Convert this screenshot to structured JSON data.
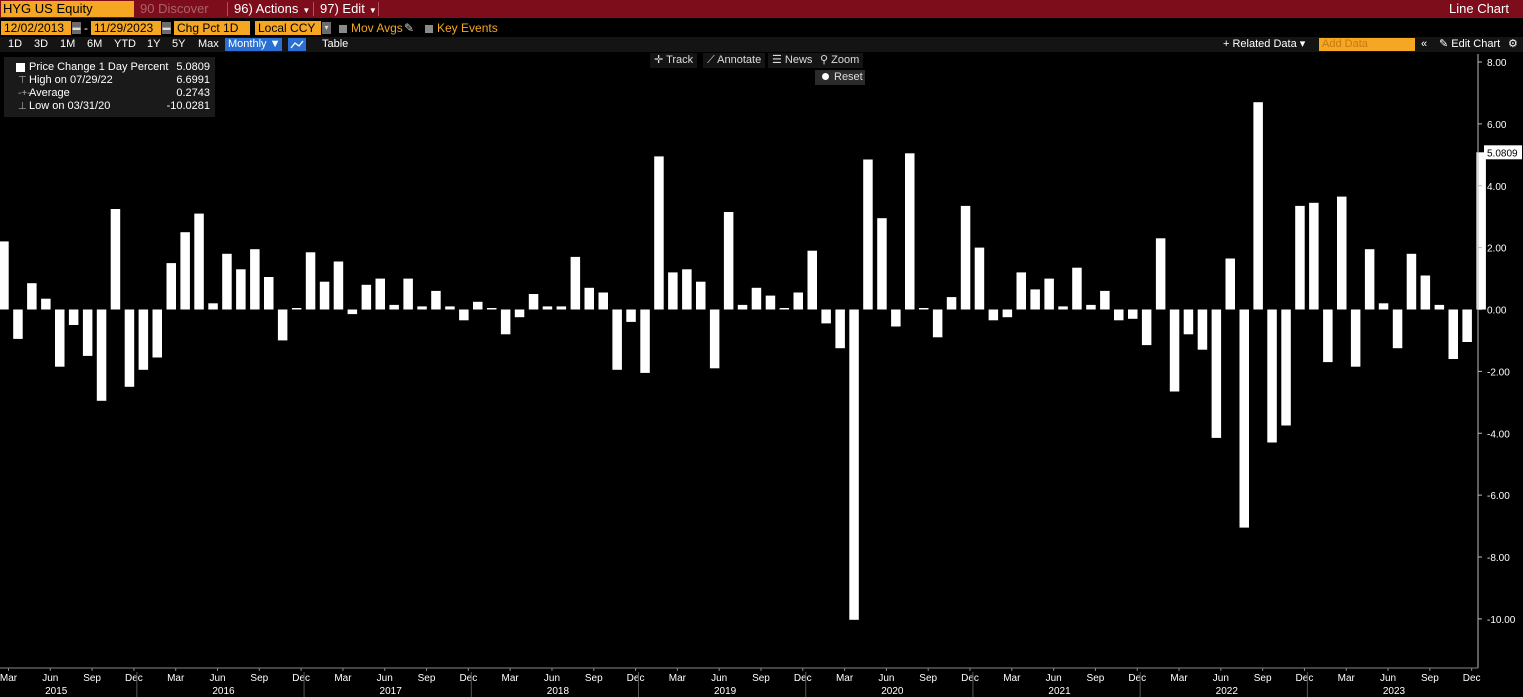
{
  "topbar": {
    "ticker": "HYG US Equity",
    "discover": "90 Discover",
    "actions": "96) Actions",
    "edit": "97) Edit",
    "chart_type": "Line Chart"
  },
  "controls": {
    "start_date": "12/02/2013",
    "end_date": "11/29/2023",
    "field": "Chg Pct 1D",
    "currency": "Local CCY",
    "mov_avgs": "Mov Avgs",
    "key_events": "Key Events"
  },
  "ranges": [
    "1D",
    "3D",
    "1M",
    "6M",
    "YTD",
    "1Y",
    "5Y",
    "Max"
  ],
  "period": "Monthly",
  "table_label": "Table",
  "right_tools": {
    "related_data": "Related Data",
    "add_data_placeholder": "Add Data",
    "edit_chart": "Edit Chart"
  },
  "chart_tools": {
    "track": "Track",
    "annotate": "Annotate",
    "news": "News",
    "zoom": "Zoom",
    "reset": "Reset"
  },
  "legend": {
    "series_label": "Price Change 1 Day Percent",
    "series_value": "5.0809",
    "high_label": "High on 07/29/22",
    "high_value": "6.6991",
    "avg_label": "Average",
    "avg_value": "0.2743",
    "low_label": "Low on 03/31/20",
    "low_value": "-10.0281"
  },
  "colors": {
    "accent": "#f5a623",
    "topbar": "#7d0d1b",
    "bars": "#ffffff",
    "background": "#000000",
    "button_blue": "#2a6fd1"
  },
  "chart_data": {
    "type": "bar",
    "series": [
      {
        "name": "Price Change 1 Day Percent",
        "values": [
          2.2,
          -0.95,
          0.85,
          0.35,
          -1.85,
          -0.5,
          -1.5,
          -2.95,
          3.25,
          -2.5,
          -1.95,
          -1.55,
          1.5,
          2.5,
          3.1,
          0.2,
          1.8,
          1.3,
          1.95,
          1.05,
          -1.0,
          0.05,
          1.85,
          0.9,
          1.55,
          -0.15,
          0.8,
          1.0,
          0.15,
          1.0,
          0.1,
          0.6,
          0.1,
          -0.35,
          0.25,
          0.05,
          -0.8,
          -0.25,
          0.5,
          0.1,
          0.1,
          1.7,
          0.7,
          0.55,
          -1.95,
          -0.4,
          -2.05,
          4.95,
          1.2,
          1.3,
          0.9,
          -1.9,
          3.15,
          0.15,
          0.7,
          0.45,
          0.05,
          0.55,
          1.9,
          -0.45,
          -1.25,
          -10.03,
          4.85,
          2.95,
          -0.55,
          5.05,
          0.05,
          -0.9,
          0.4,
          3.35,
          2.0,
          -0.35,
          -0.25,
          1.2,
          0.65,
          1.0,
          0.1,
          1.35,
          0.15,
          0.6,
          -0.35,
          -0.3,
          -1.15,
          2.3,
          -2.65,
          -0.8,
          -1.3,
          -4.15,
          1.65,
          -7.05,
          6.7,
          -4.3,
          -3.75,
          3.35,
          3.45,
          -1.7,
          3.65,
          -1.85,
          1.95,
          0.2,
          -1.25,
          1.8,
          1.1,
          0.15,
          -1.6,
          -1.05,
          5.08
        ]
      }
    ],
    "last_value": "5.0809",
    "ylim": [
      -11.0,
      8.0
    ],
    "y_ticks": [
      "8.00",
      "6.00",
      "4.00",
      "2.00",
      "0.00",
      "-2.00",
      "-4.00",
      "-6.00",
      "-8.00",
      "-10.00"
    ],
    "x_month_labels": [
      "Mar",
      "Jun",
      "Sep",
      "Dec",
      "Mar",
      "Jun",
      "Sep",
      "Dec",
      "Mar",
      "Jun",
      "Sep",
      "Dec",
      "Mar",
      "Jun",
      "Sep",
      "Dec",
      "Mar",
      "Jun",
      "Sep",
      "Dec",
      "Mar",
      "Jun",
      "Sep",
      "Dec",
      "Mar",
      "Jun",
      "Sep",
      "Dec",
      "Mar",
      "Jun",
      "Sep",
      "Dec",
      "Mar",
      "Jun",
      "Sep",
      "Dec"
    ],
    "x_year_labels": [
      "2015",
      "2016",
      "2017",
      "2018",
      "2019",
      "2020",
      "2021",
      "2022",
      "2023"
    ],
    "grid": false,
    "legend_position": "top-left"
  }
}
